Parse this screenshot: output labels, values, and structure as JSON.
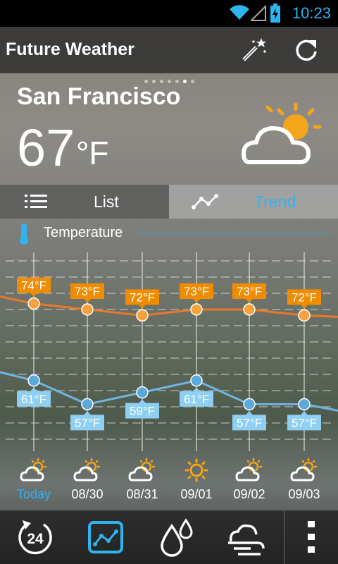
{
  "status": {
    "time": "10:23"
  },
  "app": {
    "title": "Future Weather"
  },
  "current": {
    "city": "San Francisco",
    "temp": "67",
    "unit": "°F"
  },
  "tabs": [
    {
      "label": "List"
    },
    {
      "label": "Trend"
    }
  ],
  "section": {
    "label": "Temperature"
  },
  "colors": {
    "accent": "#2fb4f0",
    "high": "#e8782a",
    "high_badge": "#f08c00",
    "low": "#6fb6e2",
    "low_badge": "#8fcff2"
  },
  "icons": {
    "wand": "magic-wand-icon",
    "refresh": "refresh-icon",
    "weather": "partly-cloudy-icon",
    "nav": [
      "24-hour-icon",
      "trend-icon",
      "humidity-icon",
      "wind-icon",
      "more-icon"
    ]
  },
  "chart_data": {
    "type": "line",
    "categories": [
      "Today",
      "08/30",
      "08/31",
      "09/01",
      "09/02",
      "09/03"
    ],
    "series": [
      {
        "values": [
          74,
          73,
          72,
          73,
          73,
          72
        ],
        "labels": [
          "74°F",
          "73°F",
          "72°F",
          "73°F",
          "73°F",
          "72°F"
        ]
      },
      {
        "values": [
          61,
          57,
          59,
          61,
          57,
          57
        ],
        "labels": [
          "61°F",
          "57°F",
          "59°F",
          "61°F",
          "57°F",
          "57°F"
        ]
      }
    ]
  },
  "forecast": [
    {
      "label": "Today",
      "icon": "partly-cloudy-icon"
    },
    {
      "label": "08/30",
      "icon": "partly-cloudy-icon"
    },
    {
      "label": "08/31",
      "icon": "partly-cloudy-icon"
    },
    {
      "label": "09/01",
      "icon": "sunny-icon"
    },
    {
      "label": "09/02",
      "icon": "partly-cloudy-icon"
    },
    {
      "label": "09/03",
      "icon": "partly-cloudy-icon"
    }
  ]
}
